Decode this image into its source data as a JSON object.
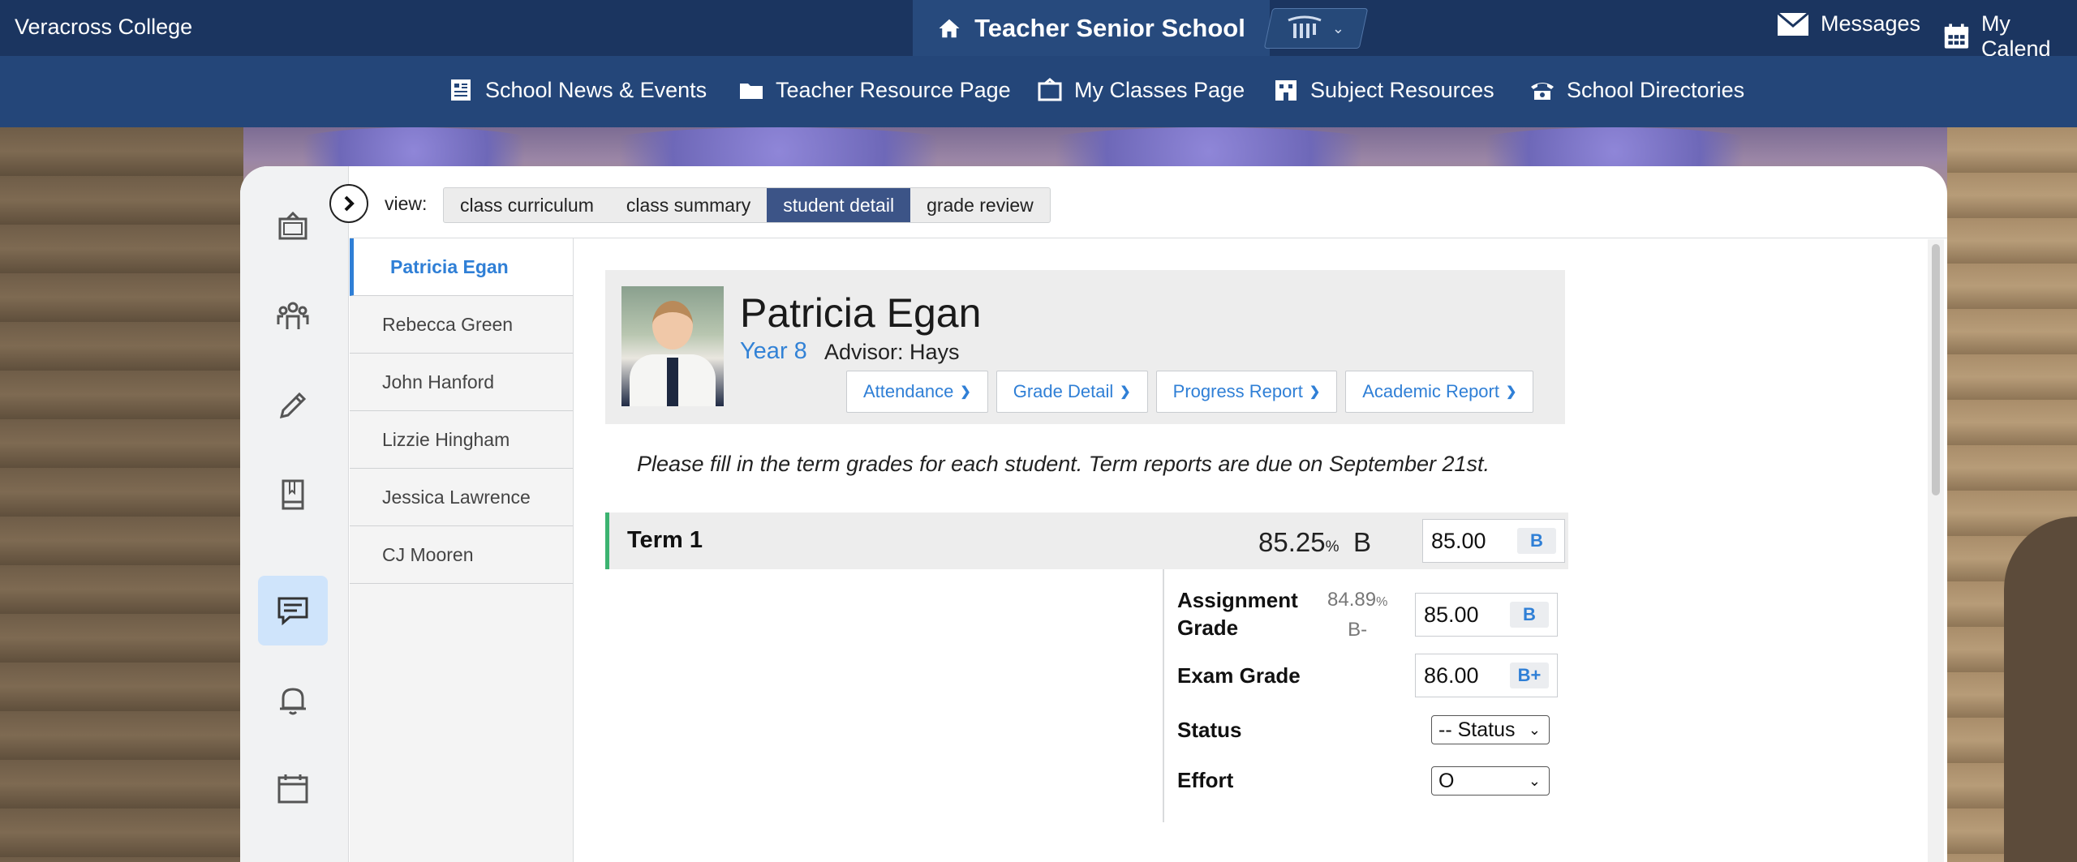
{
  "topbar": {
    "brand": "Veracross College",
    "school": "Teacher Senior School",
    "messages": "Messages",
    "calendar": "My Calend"
  },
  "subnav": {
    "items": [
      {
        "label": "School News & Events",
        "icon": "news-icon"
      },
      {
        "label": "Teacher Resource Page",
        "icon": "folder-icon"
      },
      {
        "label": "My Classes Page",
        "icon": "classroom-icon"
      },
      {
        "label": "Subject Resources",
        "icon": "building-icon"
      },
      {
        "label": "School Directories",
        "icon": "phone-icon"
      }
    ]
  },
  "view": {
    "label": "view:",
    "tabs": [
      "class curriculum",
      "class summary",
      "student detail",
      "grade review"
    ],
    "active": "student detail"
  },
  "students": [
    "Patricia Egan",
    "Rebecca Green",
    "John Hanford",
    "Lizzie Hingham",
    "Jessica Lawrence",
    "CJ Mooren"
  ],
  "student": {
    "name": "Patricia Egan",
    "year": "Year 8",
    "advisor": "Advisor: Hays",
    "buttons": [
      "Attendance",
      "Grade Detail",
      "Progress Report",
      "Academic Report"
    ]
  },
  "notice": "Please fill in the term grades for each student. Term reports are due on September 21st.",
  "term": {
    "title": "Term 1",
    "pct": "85.25",
    "pct_sign": "%",
    "letter": "B",
    "grade_value": "85.00",
    "grade_letter": "B"
  },
  "rows": {
    "assignment_label_1": "Assignment",
    "assignment_label_2": "Grade",
    "assignment_pct": "84.89",
    "assignment_pct_sign": "%",
    "assignment_letter_calc": "B-",
    "assignment_value": "85.00",
    "assignment_letter": "B",
    "exam_label": "Exam Grade",
    "exam_value": "86.00",
    "exam_letter": "B+",
    "status_label": "Status",
    "status_value": "-- Status",
    "effort_label": "Effort",
    "effort_value": "O"
  },
  "colors": {
    "topbar": "#1b3560",
    "subnav": "#244679",
    "accent": "#2f7fd6",
    "active_tab": "#3c5487",
    "term_marker": "#3cb371"
  }
}
